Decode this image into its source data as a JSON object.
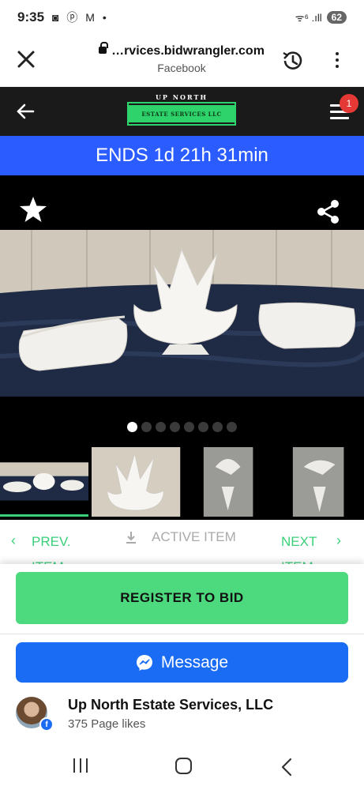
{
  "status": {
    "time": "9:35",
    "notifications": "◙ ⓟ M •",
    "battery": "62",
    "signal": "ᯤ⁶ .ıll"
  },
  "browser": {
    "url": "…rvices.bidwrangler.com",
    "source": "Facebook"
  },
  "header": {
    "logo_top": "UP NORTH",
    "logo_band": "ESTATE SERVICES LLC",
    "cart_badge": "1"
  },
  "auction": {
    "ends_label": "ENDS 1d 21h 31min"
  },
  "gallery": {
    "dot_count": 8,
    "active_dot": 0
  },
  "item_nav": {
    "prev_label": "PREV. ITEM",
    "active_label": "ACTIVE ITEM",
    "next_label": "NEXT ITEM"
  },
  "actions": {
    "register_label": "REGISTER TO BID",
    "message_label": "Message"
  },
  "page": {
    "name": "Up North Estate Services, LLC",
    "likes": "375 Page likes"
  },
  "colors": {
    "ends_bar": "#2b5cff",
    "register": "#4dd97e",
    "message": "#1a6cf5",
    "nav_green": "#3bcf7a"
  }
}
